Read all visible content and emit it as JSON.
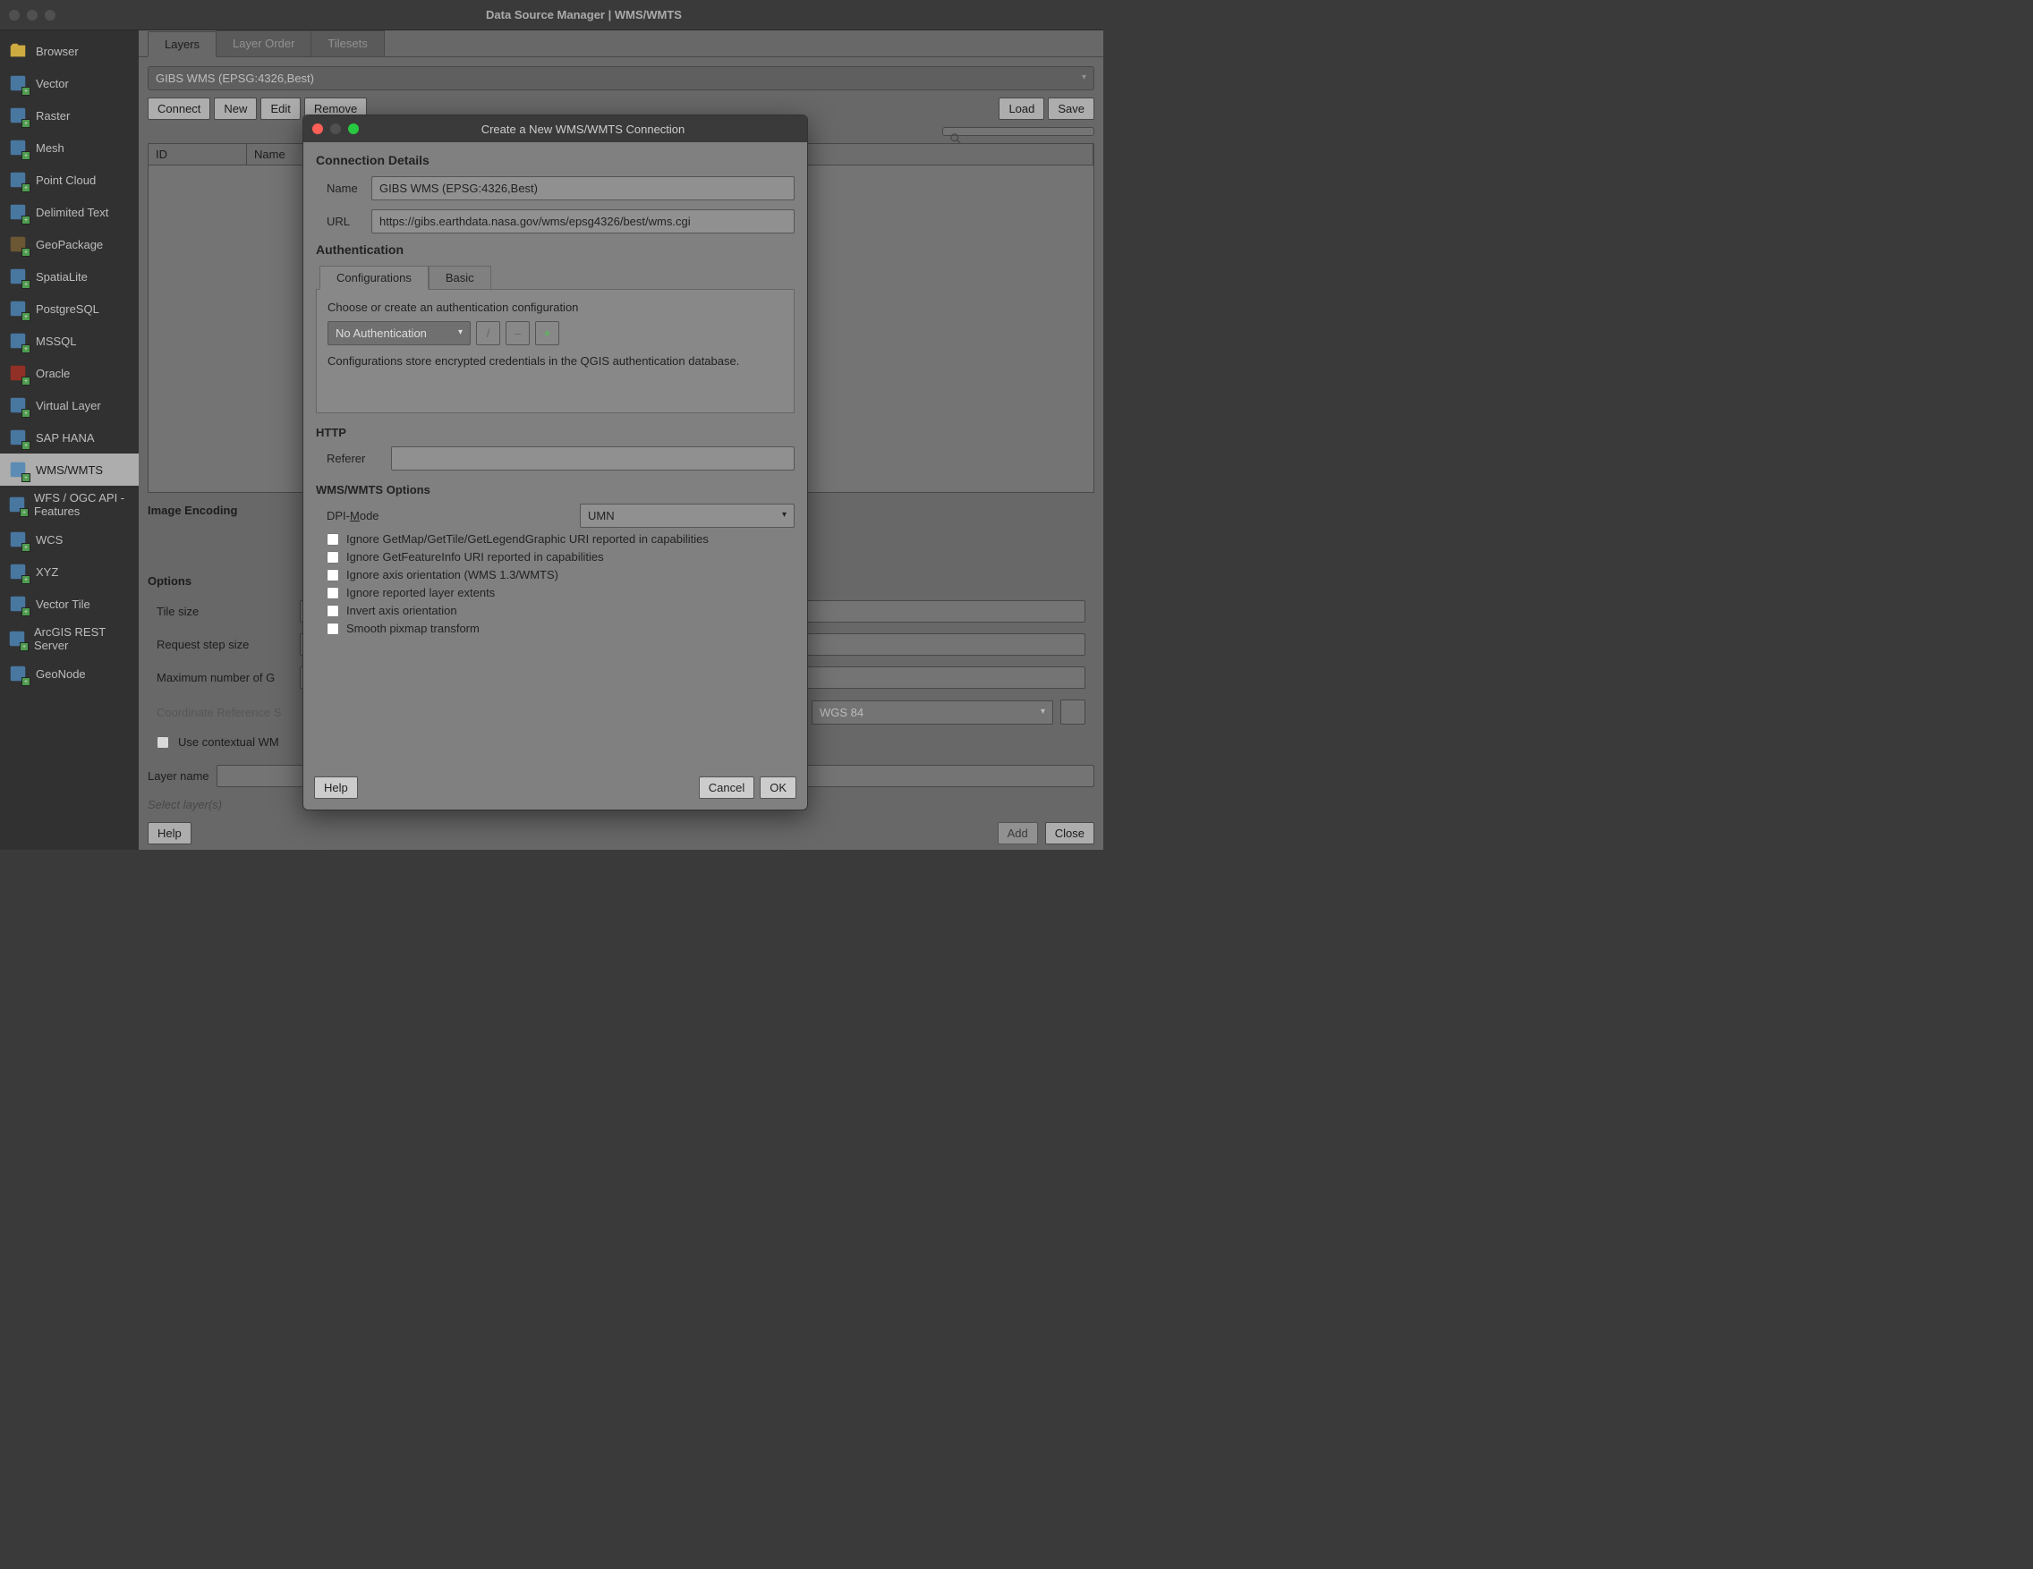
{
  "window": {
    "title": "Data Source Manager | WMS/WMTS"
  },
  "sidebar": {
    "items": [
      {
        "label": "Browser"
      },
      {
        "label": "Vector"
      },
      {
        "label": "Raster"
      },
      {
        "label": "Mesh"
      },
      {
        "label": "Point Cloud"
      },
      {
        "label": "Delimited Text"
      },
      {
        "label": "GeoPackage"
      },
      {
        "label": "SpatiaLite"
      },
      {
        "label": "PostgreSQL"
      },
      {
        "label": "MSSQL"
      },
      {
        "label": "Oracle"
      },
      {
        "label": "Virtual Layer"
      },
      {
        "label": "SAP HANA"
      },
      {
        "label": "WMS/WMTS"
      },
      {
        "label": "WFS / OGC API - Features"
      },
      {
        "label": "WCS"
      },
      {
        "label": "XYZ"
      },
      {
        "label": "Vector Tile"
      },
      {
        "label": "ArcGIS REST Server"
      },
      {
        "label": "GeoNode"
      }
    ],
    "selected_index": 13
  },
  "tabs": {
    "items": [
      "Layers",
      "Layer Order",
      "Tilesets"
    ],
    "active_index": 0
  },
  "connection_combo": "GIBS WMS (EPSG:4326,Best)",
  "toolbar": {
    "connect": "Connect",
    "new": "New",
    "edit": "Edit",
    "remove": "Remove",
    "load": "Load",
    "save": "Save"
  },
  "table": {
    "headers": [
      "ID",
      "Name"
    ]
  },
  "sections": {
    "image_encoding": "Image Encoding",
    "options": "Options"
  },
  "options": {
    "tile_size": "Tile size",
    "request_step": "Request step size",
    "max_getmap_prefix": "Maximum number of G",
    "crs_prefix": "Coordinate Reference S",
    "crs_value": "WGS 84",
    "contextual": "Use contextual WM"
  },
  "footer": {
    "layer_name_label": "Layer name",
    "select_layers": "Select layer(s)",
    "help": "Help",
    "add": "Add",
    "close": "Close"
  },
  "modal": {
    "title": "Create a New WMS/WMTS Connection",
    "h_connection": "Connection Details",
    "name_label": "Name",
    "name_value": "GIBS WMS (EPSG:4326,Best)",
    "url_label": "URL",
    "url_value": "https://gibs.earthdata.nasa.gov/wms/epsg4326/best/wms.cgi",
    "h_auth": "Authentication",
    "auth_tabs": [
      "Configurations",
      "Basic"
    ],
    "auth_hint": "Choose or create an authentication configuration",
    "auth_select": "No Authentication",
    "auth_desc": "Configurations store encrypted credentials in the QGIS authentication database.",
    "h_http": "HTTP",
    "referer_label": "Referer",
    "h_wms": "WMS/WMTS Options",
    "dpi_label": "DPI-Mode",
    "dpi_value": "UMN",
    "checks": [
      "Ignore GetMap/GetTile/GetLegendGraphic URI reported in capabilities",
      "Ignore GetFeatureInfo URI reported in capabilities",
      "Ignore axis orientation (WMS 1.3/WMTS)",
      "Ignore reported layer extents",
      "Invert axis orientation",
      "Smooth pixmap transform"
    ],
    "help": "Help",
    "cancel": "Cancel",
    "ok": "OK"
  }
}
